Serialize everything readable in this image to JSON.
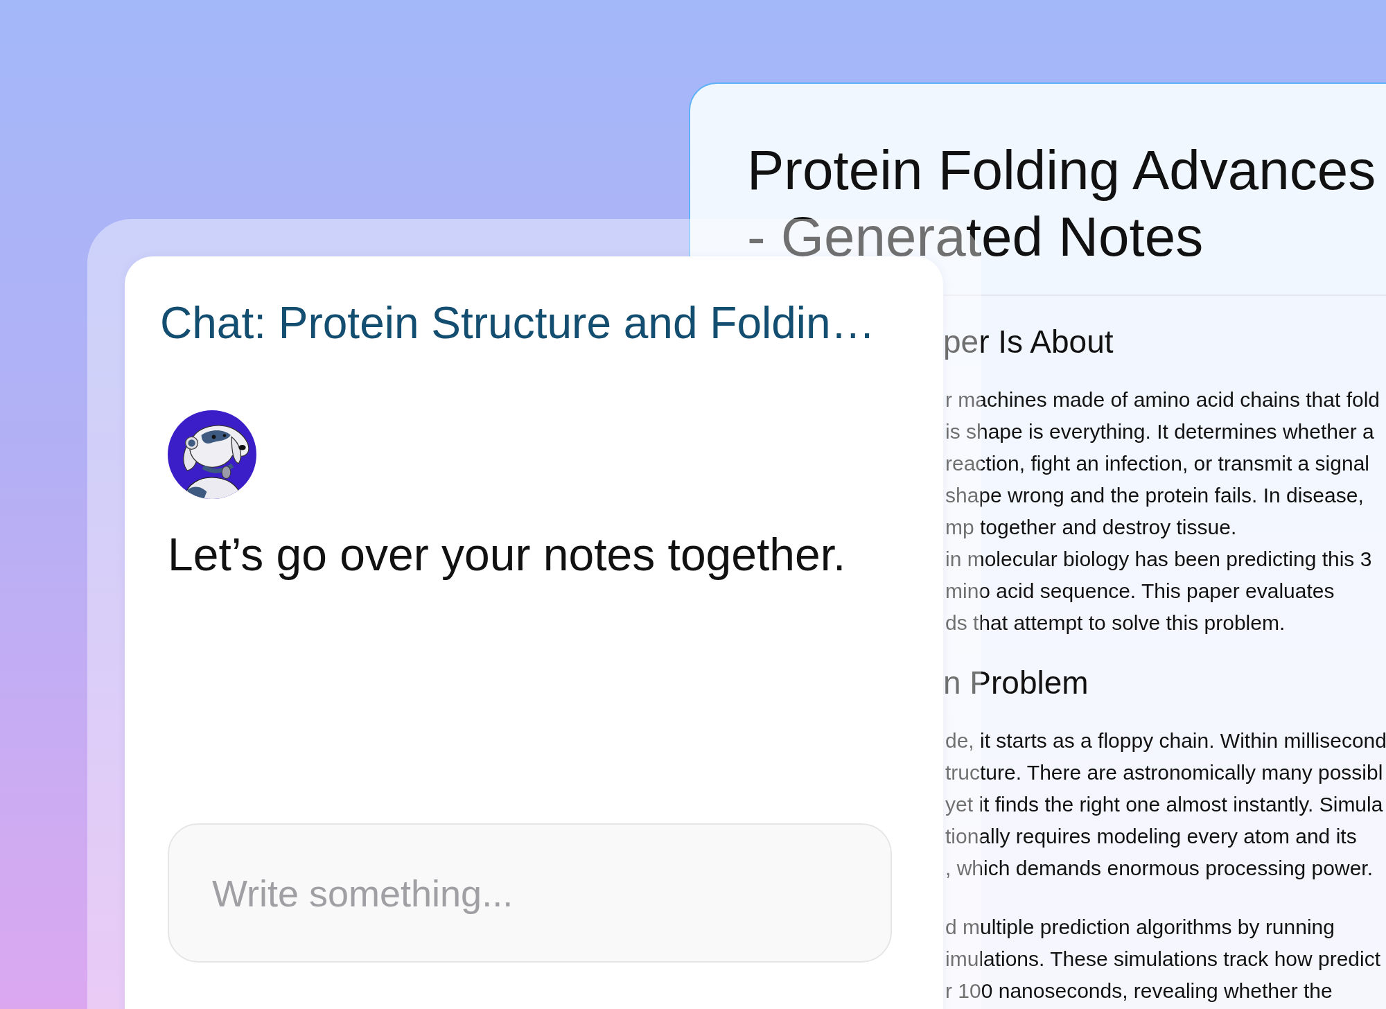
{
  "notes_window": {
    "title": "Protein Folding Advances - Generated Notes",
    "sections": [
      {
        "heading": "per Is About",
        "paragraphs": [
          {
            "lines": [
              "r machines made of amino acid chains that fold",
              "is shape is everything. It determines whether a",
              "reaction, fight an infection, or transmit a signal",
              "shape wrong and the protein fails. In disease,",
              "mp together and destroy tissue.",
              "in molecular biology has been predicting this 3",
              "mino acid sequence. This paper evaluates",
              "ds that attempt to solve this problem."
            ]
          }
        ]
      },
      {
        "heading": "n Problem",
        "paragraphs": [
          {
            "lines": [
              "de, it starts as a floppy chain. Within millisecond",
              "tructure. There are astronomically many possibl",
              "yet it finds the right one almost instantly. Simula",
              "tionally requires modeling every atom and its",
              ", which demands enormous processing power."
            ]
          },
          {
            "lines": [
              "d multiple prediction algorithms by running",
              "imulations. These simulations track how predict",
              "r 100 nanoseconds, revealing whether the"
            ]
          }
        ]
      }
    ]
  },
  "chat_window": {
    "title": "Chat: Protein Structure and Foldin…",
    "messages": [
      {
        "text": "Let’s go over your notes together."
      }
    ],
    "input": {
      "placeholder": "Write something..."
    }
  }
}
